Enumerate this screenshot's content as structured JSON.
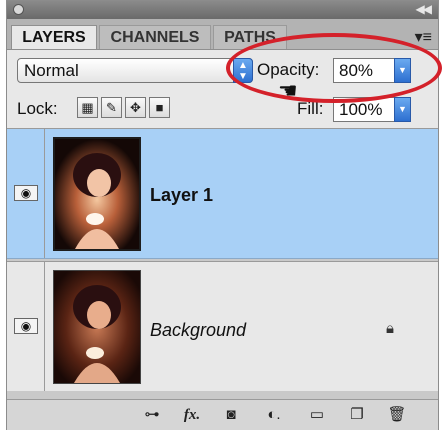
{
  "tabs": [
    {
      "label": "LAYERS",
      "active": true
    },
    {
      "label": "CHANNELS",
      "active": false
    },
    {
      "label": "PATHS",
      "active": false
    }
  ],
  "blend_mode": {
    "value": "Normal"
  },
  "opacity": {
    "label": "Opacity:",
    "value": "80%"
  },
  "fill": {
    "label": "Fill:",
    "value": "100%"
  },
  "lock": {
    "label": "Lock:"
  },
  "layers": [
    {
      "name": "Layer 1",
      "selected": true,
      "visible": true
    },
    {
      "name": "Background",
      "selected": false,
      "visible": true,
      "locked": true
    }
  ],
  "icons": {
    "link": "link-icon",
    "fx": "fx",
    "mask": "mask-icon",
    "adjustment": "adjustment-icon",
    "group": "folder-icon",
    "new_layer": "new-layer-icon",
    "delete": "trash-icon"
  },
  "colors": {
    "selection": "#a8d0f6",
    "annotation": "#d4212a",
    "accent": "#2d6fd0"
  }
}
